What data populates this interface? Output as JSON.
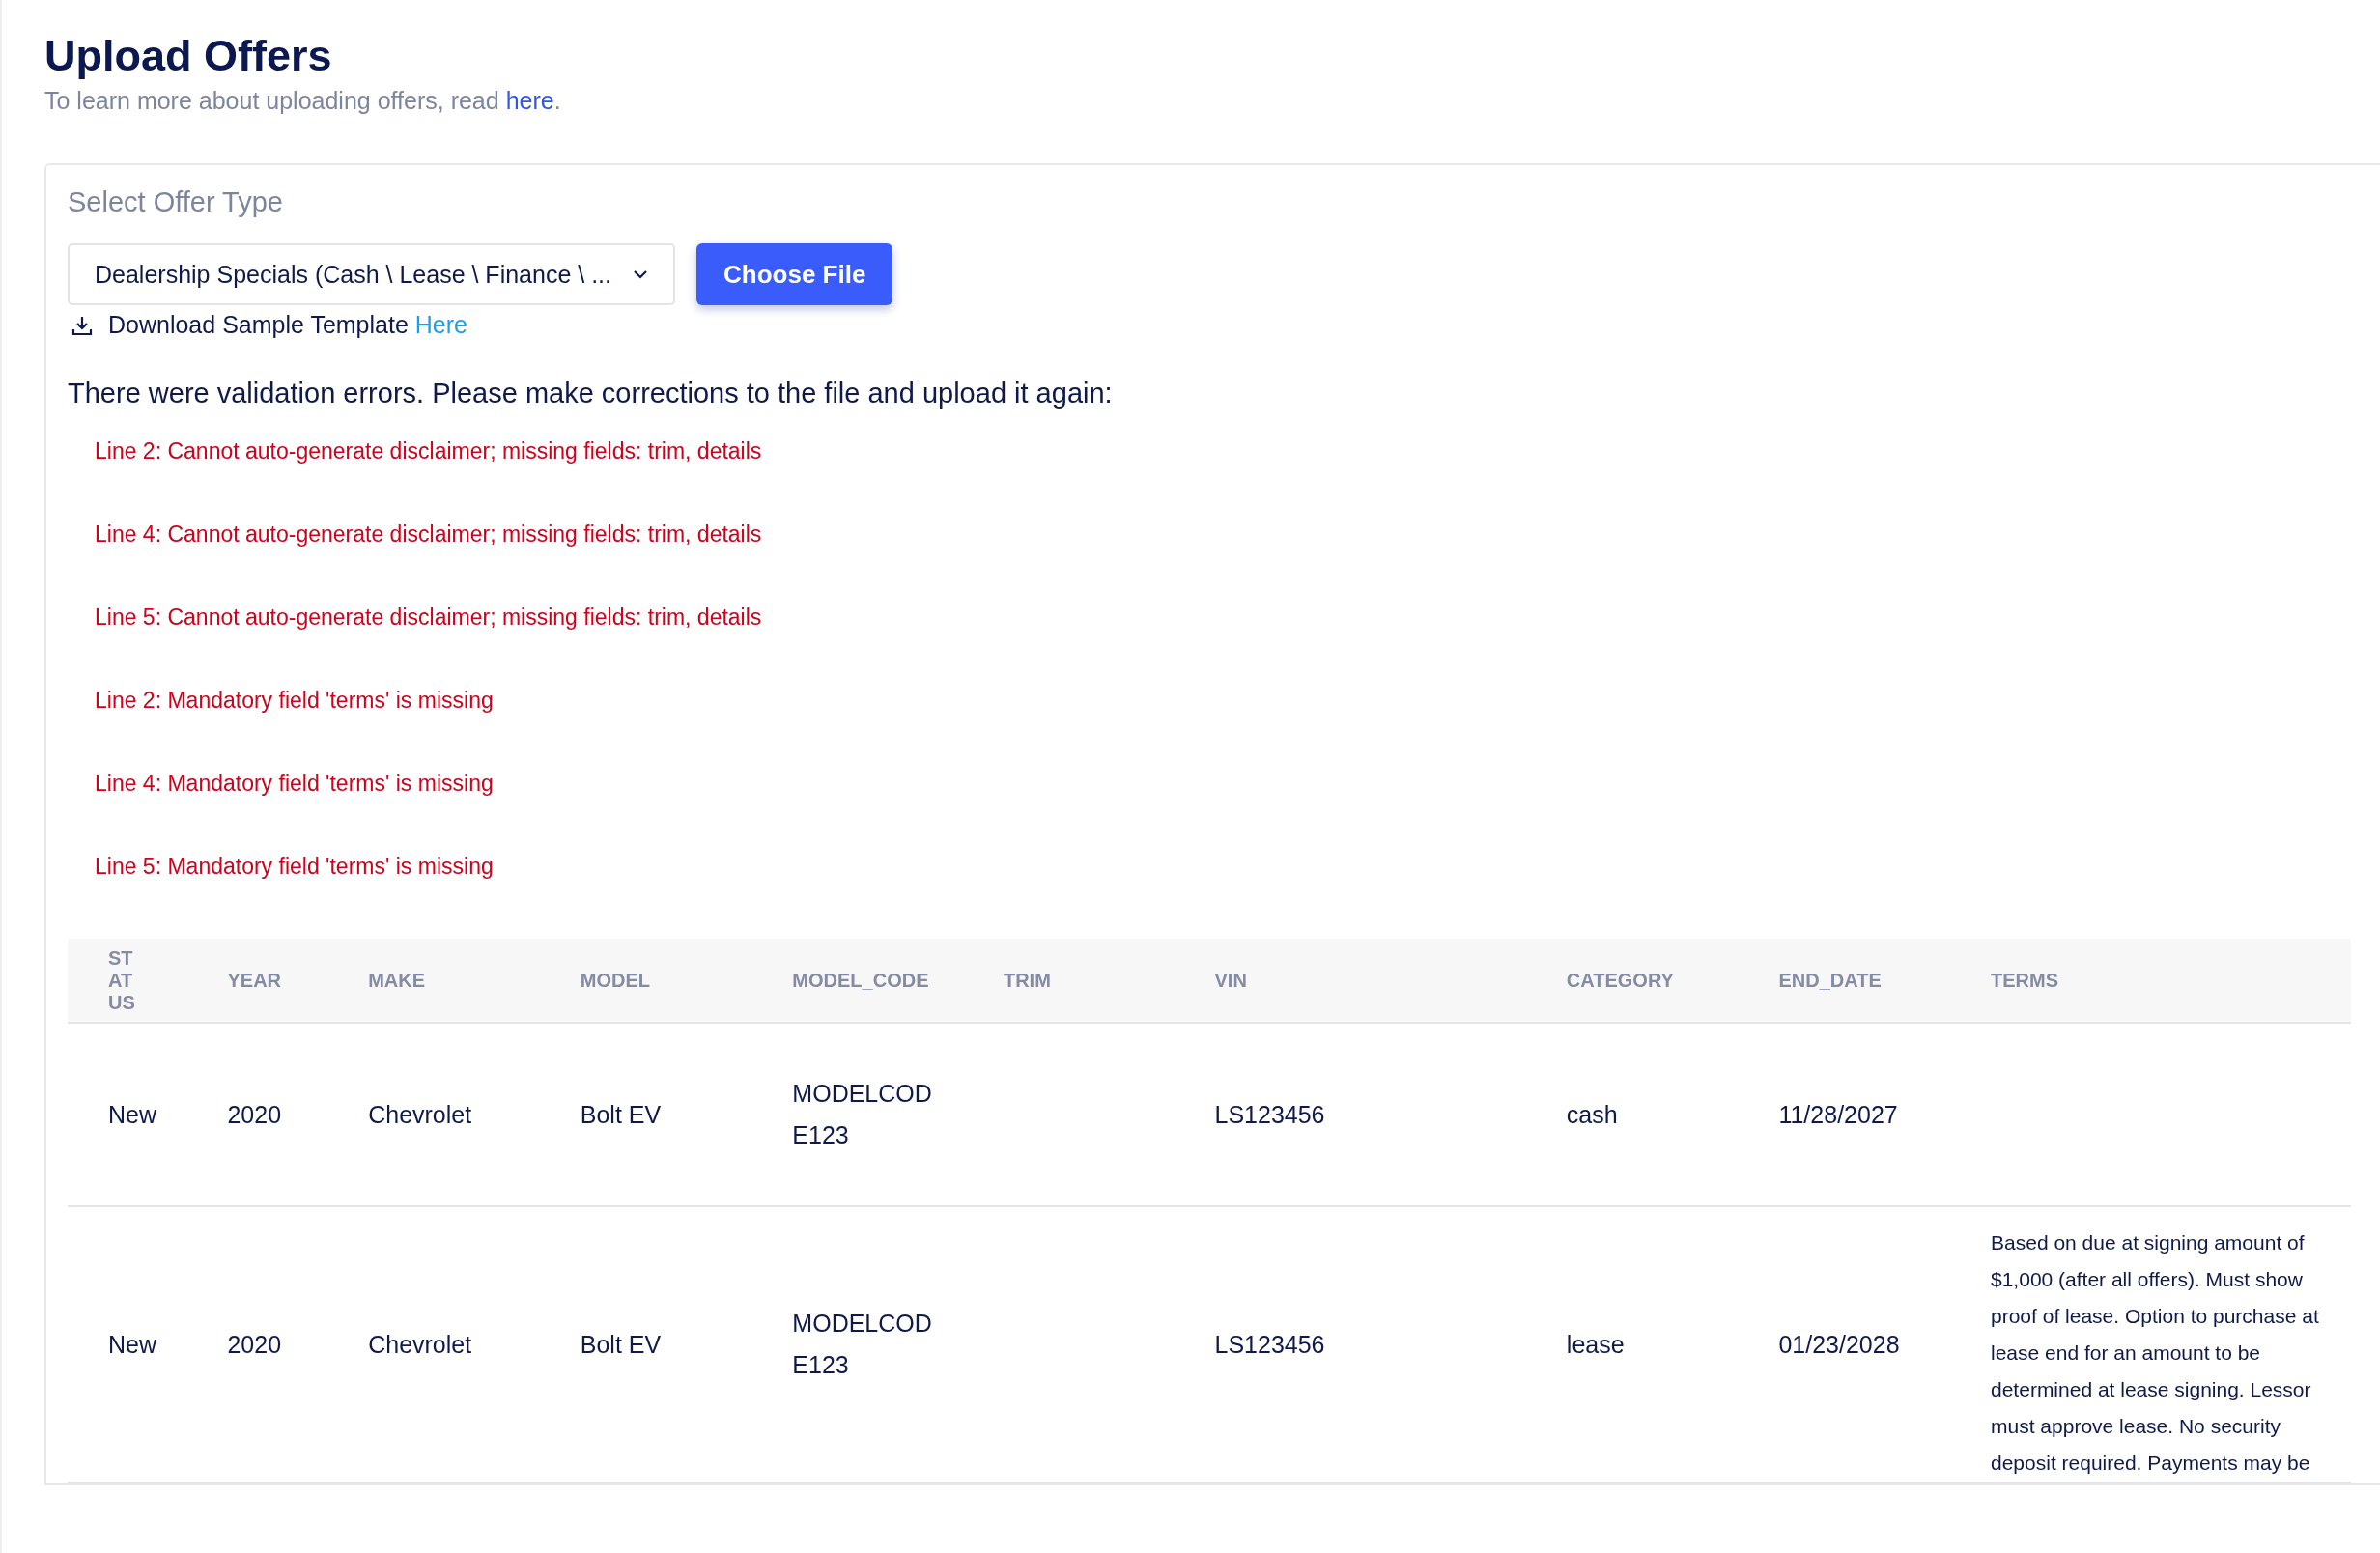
{
  "page": {
    "title": "Upload Offers",
    "subtitle": {
      "text": "To learn more about uploading offers, read ",
      "link": "here",
      "after": "."
    }
  },
  "upload": {
    "label": "Select Offer Type",
    "offer_type": "Dealership Specials (Cash \\ Lease \\ Finance \\ ...",
    "choose_button": "Choose File",
    "template": {
      "text": "Download Sample Template ",
      "link": "Here"
    }
  },
  "validation": {
    "message": "There were validation errors. Please make corrections to the file and upload it again:",
    "errors": [
      "Line 2: Cannot auto-generate disclaimer; missing fields: trim, details",
      "Line 4: Cannot auto-generate disclaimer; missing fields: trim, details",
      "Line 5: Cannot auto-generate disclaimer; missing fields: trim, details",
      "Line 2: Mandatory field 'terms' is missing",
      "Line 4: Mandatory field 'terms' is missing",
      "Line 5: Mandatory field 'terms' is missing"
    ]
  },
  "table": {
    "columns": [
      "STATUS",
      "YEAR",
      "MAKE",
      "MODEL",
      "MODEL_CODE",
      "TRIM",
      "VIN",
      "CATEGORY",
      "END_DATE",
      "TERMS"
    ],
    "rows": [
      [
        "New",
        "2020",
        "Chevrolet",
        "Bolt EV",
        "MODELCODE123",
        null,
        "LS123456",
        "cash",
        "11/28/2027",
        null
      ],
      [
        "New",
        "2020",
        "Chevrolet",
        "Bolt EV",
        "MODELCODE123",
        null,
        "LS123456",
        "lease",
        "01/23/2028",
        "Based on due at signing amount of $1,000 (after all offers). Must show proof of lease. Option to purchase at lease end for an amount to be determined at lease signing. Lessor must approve lease. No security deposit required. Payments may be"
      ]
    ]
  }
}
